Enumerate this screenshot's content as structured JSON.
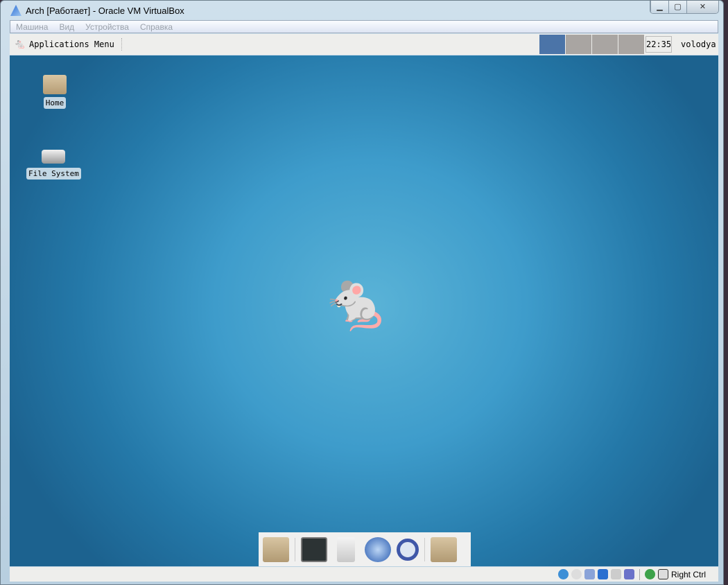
{
  "window": {
    "title": "Arch [Работает] - Oracle VM VirtualBox",
    "min": "▁",
    "max": "▢",
    "close": "✕"
  },
  "menu": [
    "Машина",
    "Вид",
    "Устройства",
    "Справка"
  ],
  "panel": {
    "app_menu": "Applications Menu",
    "clock": "22:35",
    "user": "volodya",
    "workspaces": 4,
    "active_workspace": 1
  },
  "desktop": {
    "icons": [
      {
        "label": "Home"
      },
      {
        "label": "File System"
      }
    ]
  },
  "dock": [
    "file-manager",
    "terminal",
    "file-cabinet",
    "web-browser",
    "search",
    "folder"
  ],
  "status": {
    "host_key": "Right Ctrl"
  }
}
